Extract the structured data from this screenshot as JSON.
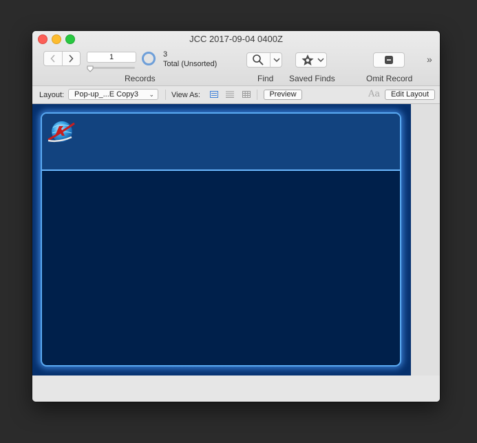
{
  "window": {
    "title": "JCC 2017-09-04 0400Z"
  },
  "toolbar": {
    "record_number": "1",
    "records_label": "Records",
    "found_count": "3",
    "total_text": "Total (Unsorted)",
    "find_label": "Find",
    "saved_finds_label": "Saved Finds",
    "omit_label": "Omit Record",
    "overflow": "»"
  },
  "layout_bar": {
    "layout_label": "Layout:",
    "layout_value": "Pop-up_...E Copy3",
    "view_as_label": "View As:",
    "preview_label": "Preview",
    "edit_layout_label": "Edit Layout",
    "text_format_icon": "Aa"
  },
  "colors": {
    "canvas_bg": "#07306b",
    "panel_bg": "#00204b",
    "panel_header_bg": "#12437f",
    "panel_glow": "#5aaaf2",
    "accent_blue": "#3b7fd9"
  },
  "icons": {
    "back": "chevron-left-icon",
    "forward": "chevron-right-icon",
    "find": "magnifier-icon",
    "saved_finds": "star-icon",
    "omit": "minus-square-icon",
    "view_form": "form-view-icon",
    "view_list": "list-view-icon",
    "view_table": "table-view-icon",
    "logo": "globe-logo-icon"
  }
}
